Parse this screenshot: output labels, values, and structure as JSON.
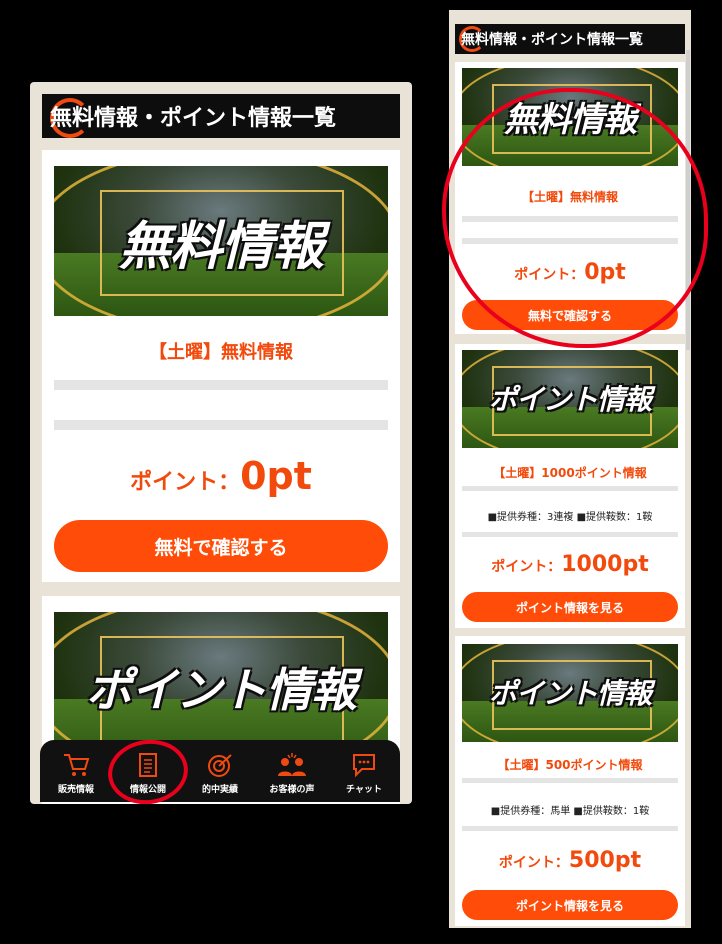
{
  "header": {
    "title": "無料情報・ポイント情報一覧"
  },
  "banners": {
    "free": "無料情報",
    "point": "ポイント情報"
  },
  "points_label": "ポイント：",
  "cards": [
    {
      "title": "【土曜】無料情報",
      "points": "0pt",
      "button": "無料で確認する"
    },
    {
      "title": "【土曜】1000ポイント情報",
      "meta": "■提供券種：3連複 ■提供鞍数：1鞍",
      "points": "1000pt",
      "button": "ポイント情報を見る"
    },
    {
      "title": "【土曜】500ポイント情報",
      "meta": "■提供券種：馬単 ■提供鞍数：1鞍",
      "points": "500pt",
      "button": "ポイント情報を見る"
    }
  ],
  "nav": [
    {
      "label": "販売情報",
      "icon": "cart-icon"
    },
    {
      "label": "情報公開",
      "icon": "document-icon"
    },
    {
      "label": "的中実績",
      "icon": "target-icon"
    },
    {
      "label": "お客様の声",
      "icon": "people-icon"
    },
    {
      "label": "チャット",
      "icon": "chat-bubble-icon"
    }
  ],
  "colors": {
    "accent": "#ff4c08",
    "text_accent": "#f24a0c",
    "annotation": "#e8001c",
    "header_bg": "#0d0d0d"
  }
}
